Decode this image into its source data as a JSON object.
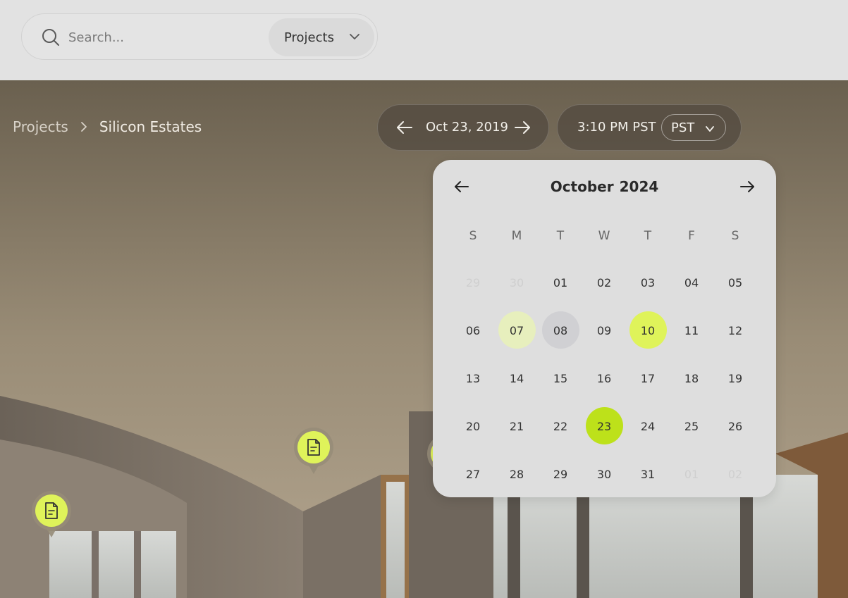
{
  "search": {
    "placeholder": "Search...",
    "scope_label": "Projects"
  },
  "breadcrumb": {
    "root": "Projects",
    "current": "Silicon Estates"
  },
  "date_nav": {
    "date": "Oct 23, 2019"
  },
  "time_nav": {
    "time": "3:10 PM PST",
    "timezone": "PST"
  },
  "calendar": {
    "month": "October",
    "year": "2024",
    "weekdays": [
      "S",
      "M",
      "T",
      "W",
      "T",
      "F",
      "S"
    ],
    "days": [
      {
        "label": "29",
        "state": "muted"
      },
      {
        "label": "30",
        "state": "muted"
      },
      {
        "label": "01",
        "state": ""
      },
      {
        "label": "02",
        "state": ""
      },
      {
        "label": "03",
        "state": ""
      },
      {
        "label": "04",
        "state": ""
      },
      {
        "label": "05",
        "state": ""
      },
      {
        "label": "06",
        "state": ""
      },
      {
        "label": "07",
        "state": "hl-light"
      },
      {
        "label": "08",
        "state": "hl-grey"
      },
      {
        "label": "09",
        "state": ""
      },
      {
        "label": "10",
        "state": "hl-lime"
      },
      {
        "label": "11",
        "state": ""
      },
      {
        "label": "12",
        "state": ""
      },
      {
        "label": "13",
        "state": ""
      },
      {
        "label": "14",
        "state": ""
      },
      {
        "label": "15",
        "state": ""
      },
      {
        "label": "16",
        "state": ""
      },
      {
        "label": "17",
        "state": ""
      },
      {
        "label": "18",
        "state": ""
      },
      {
        "label": "19",
        "state": ""
      },
      {
        "label": "20",
        "state": ""
      },
      {
        "label": "21",
        "state": ""
      },
      {
        "label": "22",
        "state": ""
      },
      {
        "label": "23",
        "state": "hl-strong"
      },
      {
        "label": "24",
        "state": ""
      },
      {
        "label": "25",
        "state": ""
      },
      {
        "label": "26",
        "state": ""
      },
      {
        "label": "27",
        "state": ""
      },
      {
        "label": "28",
        "state": ""
      },
      {
        "label": "29",
        "state": ""
      },
      {
        "label": "30",
        "state": ""
      },
      {
        "label": "31",
        "state": ""
      },
      {
        "label": "01",
        "state": "muted"
      },
      {
        "label": "02",
        "state": "muted"
      }
    ]
  },
  "markers": [
    {
      "icon": "document-icon"
    },
    {
      "icon": "document-icon"
    }
  ],
  "colors": {
    "accent": "#dff35a",
    "accent_strong": "#bde11a"
  }
}
